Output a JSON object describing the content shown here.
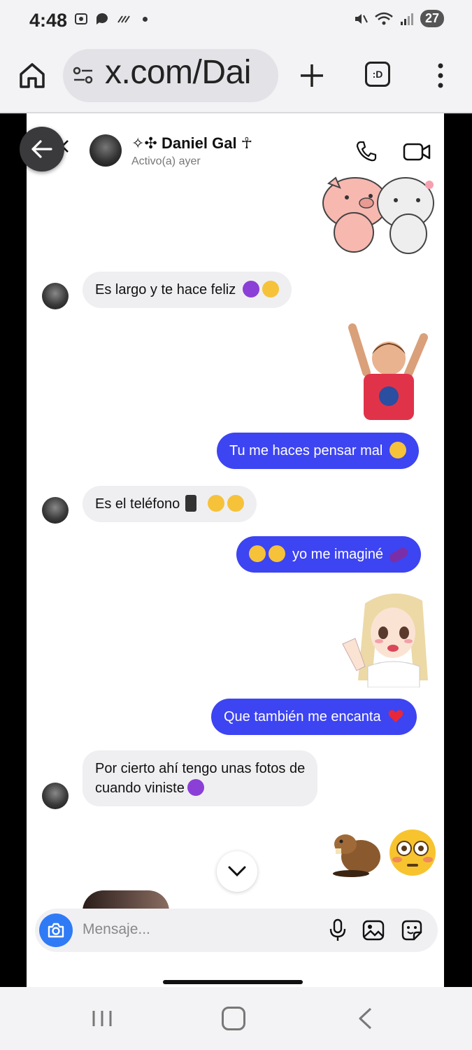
{
  "status_bar": {
    "time": "4:48",
    "battery": "27"
  },
  "browser": {
    "url": "x.com/Dai",
    "tabs_label": ":D"
  },
  "chat": {
    "contact_name": "✧✣ Daniel Gal ☥",
    "contact_status": "Activo(a) ayer",
    "messages": [
      {
        "direction": "incoming",
        "text": "Es largo y te hace feliz"
      },
      {
        "direction": "outgoing",
        "text": "Tu me haces pensar mal"
      },
      {
        "direction": "incoming",
        "text": "Es el teléfono"
      },
      {
        "direction": "outgoing",
        "text": "yo me imaginé"
      },
      {
        "direction": "outgoing",
        "text": "Que también me encanta"
      },
      {
        "direction": "incoming",
        "text_line1": "Por cierto ahí tengo unas fotos de",
        "text_line2": "cuando viniste"
      }
    ],
    "stickers": [
      "pig-and-bunny-sticker",
      "cheering-kid-sticker",
      "anime-girl-sticker",
      "beaver-sticker",
      "flushed-face-emoji"
    ],
    "input_placeholder": "Mensaje..."
  },
  "colors": {
    "outgoing_bubble": "#3d44f2",
    "incoming_bubble": "#efeff2",
    "camera_button": "#2f7bf6"
  }
}
